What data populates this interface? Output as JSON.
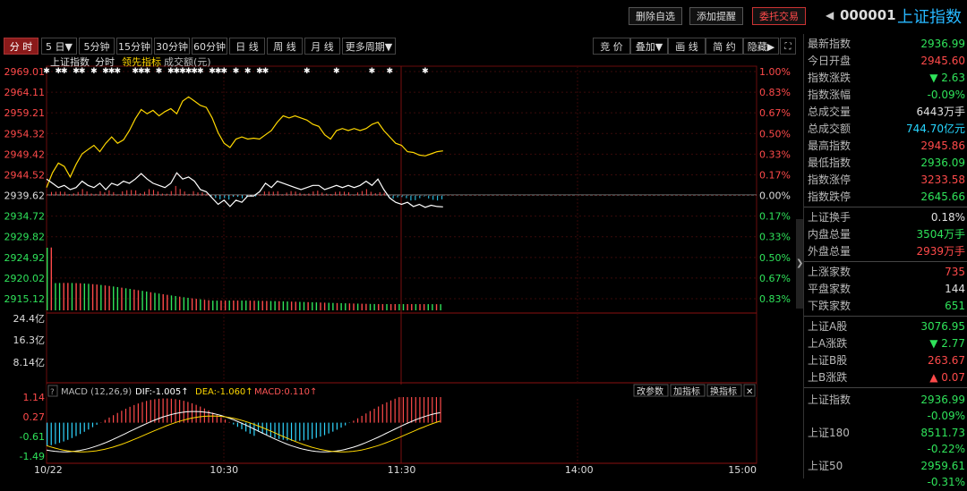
{
  "toolbar": {
    "delete_watch": "删除自选",
    "add_alert": "添加提醒",
    "delegate_trade": "委托交易",
    "code": "000001",
    "name": "上证指数"
  },
  "periods": [
    "分 时",
    "5 日▼",
    "5分钟",
    "15分钟",
    "30分钟",
    "60分钟",
    "日 线",
    "周 线",
    "月 线",
    "更多周期▼"
  ],
  "right_tools": [
    "竞 价",
    "叠加▼",
    "画 线",
    "简 约",
    "隐藏▶"
  ],
  "chart_header": {
    "name": "上证指数",
    "mode": "分时",
    "leader": "领先指标",
    "volume": "成交额(元)"
  },
  "macd_header": {
    "indicator": "MACD (12,26,9)",
    "dif": "DIF:-1.005↑",
    "dea": "DEA:-1.060↑",
    "macd": "MACD:0.110↑",
    "btn_change_params": "改参数",
    "btn_add_indicator": "加指标",
    "btn_swap_indicator": "换指标",
    "btn_close": "✕",
    "btn_help": "?"
  },
  "price_ticks": [
    "2969.01",
    "2964.11",
    "2959.21",
    "2954.32",
    "2949.42",
    "2944.52",
    "2939.62",
    "2934.72",
    "2929.82",
    "2924.92",
    "2920.02",
    "2915.12"
  ],
  "pct_ticks": [
    "1.00%",
    "0.83%",
    "0.67%",
    "0.50%",
    "0.33%",
    "0.17%",
    "0.00%",
    "0.17%",
    "0.33%",
    "0.50%",
    "0.67%",
    "0.83%"
  ],
  "volume_ticks": [
    "24.4亿",
    "16.3亿",
    "8.14亿"
  ],
  "macd_ticks": [
    "1.14",
    "0.27",
    "-0.61",
    "-1.49"
  ],
  "time_ticks": [
    "10/22",
    "10:30",
    "11:30",
    "14:00",
    "15:00"
  ],
  "chart_data": {
    "type": "line",
    "prev_close": 2939.62,
    "price_range": [
      2915.12,
      2969.01
    ],
    "x_range_minutes": [
      0,
      240
    ],
    "series": [
      {
        "name": "上证指数",
        "points": [
          [
            0,
            2941.5
          ],
          [
            2,
            2945.0
          ],
          [
            4,
            2947.3
          ],
          [
            6,
            2946.5
          ],
          [
            8,
            2944.0
          ],
          [
            10,
            2947.0
          ],
          [
            12,
            2949.5
          ],
          [
            14,
            2950.5
          ],
          [
            16,
            2951.5
          ],
          [
            18,
            2950.0
          ],
          [
            20,
            2952.0
          ],
          [
            22,
            2953.5
          ],
          [
            24,
            2952.0
          ],
          [
            26,
            2952.8
          ],
          [
            28,
            2955.0
          ],
          [
            30,
            2957.8
          ],
          [
            32,
            2960.0
          ],
          [
            34,
            2959.0
          ],
          [
            36,
            2959.8
          ],
          [
            38,
            2958.5
          ],
          [
            40,
            2959.5
          ],
          [
            42,
            2960.2
          ],
          [
            44,
            2959.0
          ],
          [
            46,
            2962.0
          ],
          [
            48,
            2963.0
          ],
          [
            50,
            2962.0
          ],
          [
            52,
            2961.0
          ],
          [
            54,
            2960.5
          ],
          [
            56,
            2958.0
          ],
          [
            58,
            2954.5
          ],
          [
            60,
            2952.0
          ],
          [
            62,
            2951.0
          ],
          [
            64,
            2953.0
          ],
          [
            66,
            2953.5
          ],
          [
            68,
            2953.0
          ],
          [
            70,
            2953.2
          ],
          [
            72,
            2953.0
          ],
          [
            74,
            2954.0
          ],
          [
            76,
            2955.0
          ],
          [
            78,
            2957.0
          ],
          [
            80,
            2958.5
          ],
          [
            82,
            2958.0
          ],
          [
            84,
            2958.5
          ],
          [
            86,
            2958.0
          ],
          [
            88,
            2957.5
          ],
          [
            90,
            2956.5
          ],
          [
            92,
            2956.0
          ],
          [
            94,
            2954.0
          ],
          [
            96,
            2953.0
          ],
          [
            98,
            2955.0
          ],
          [
            100,
            2955.5
          ],
          [
            102,
            2955.0
          ],
          [
            104,
            2955.5
          ],
          [
            106,
            2955.0
          ],
          [
            108,
            2955.5
          ],
          [
            110,
            2956.5
          ],
          [
            112,
            2957.0
          ],
          [
            114,
            2955.0
          ],
          [
            116,
            2953.5
          ],
          [
            118,
            2952.0
          ],
          [
            120,
            2951.5
          ],
          [
            122,
            2950.0
          ],
          [
            124,
            2949.8
          ],
          [
            126,
            2949.2
          ],
          [
            128,
            2949.0
          ],
          [
            130,
            2949.5
          ],
          [
            132,
            2950.0
          ],
          [
            134,
            2950.2
          ]
        ]
      },
      {
        "name": "领先指标",
        "points": [
          [
            0,
            2943.5
          ],
          [
            2,
            2942.5
          ],
          [
            4,
            2941.5
          ],
          [
            6,
            2942.0
          ],
          [
            8,
            2941.0
          ],
          [
            10,
            2941.5
          ],
          [
            12,
            2943.0
          ],
          [
            14,
            2942.0
          ],
          [
            16,
            2941.5
          ],
          [
            18,
            2942.5
          ],
          [
            20,
            2941.0
          ],
          [
            22,
            2942.5
          ],
          [
            24,
            2942.0
          ],
          [
            26,
            2943.0
          ],
          [
            28,
            2942.5
          ],
          [
            30,
            2943.5
          ],
          [
            32,
            2944.8
          ],
          [
            34,
            2943.5
          ],
          [
            36,
            2942.5
          ],
          [
            38,
            2942.0
          ],
          [
            40,
            2941.5
          ],
          [
            42,
            2942.5
          ],
          [
            44,
            2945.0
          ],
          [
            46,
            2943.5
          ],
          [
            48,
            2944.0
          ],
          [
            50,
            2943.0
          ],
          [
            52,
            2941.0
          ],
          [
            54,
            2940.5
          ],
          [
            56,
            2939.0
          ],
          [
            58,
            2937.5
          ],
          [
            60,
            2938.5
          ],
          [
            62,
            2937.0
          ],
          [
            64,
            2938.5
          ],
          [
            66,
            2938.0
          ],
          [
            68,
            2939.5
          ],
          [
            70,
            2939.5
          ],
          [
            72,
            2940.5
          ],
          [
            74,
            2942.5
          ],
          [
            76,
            2941.5
          ],
          [
            78,
            2943.0
          ],
          [
            80,
            2942.5
          ],
          [
            82,
            2942.0
          ],
          [
            84,
            2941.5
          ],
          [
            86,
            2941.0
          ],
          [
            88,
            2941.5
          ],
          [
            90,
            2942.0
          ],
          [
            92,
            2942.0
          ],
          [
            94,
            2941.0
          ],
          [
            96,
            2941.5
          ],
          [
            98,
            2942.0
          ],
          [
            100,
            2941.5
          ],
          [
            102,
            2942.0
          ],
          [
            104,
            2941.5
          ],
          [
            106,
            2942.0
          ],
          [
            108,
            2943.0
          ],
          [
            110,
            2942.0
          ],
          [
            112,
            2943.5
          ],
          [
            114,
            2941.0
          ],
          [
            116,
            2939.0
          ],
          [
            118,
            2938.0
          ],
          [
            120,
            2937.5
          ],
          [
            122,
            2938.0
          ],
          [
            124,
            2937.0
          ],
          [
            126,
            2937.5
          ],
          [
            128,
            2936.8
          ],
          [
            130,
            2937.3
          ],
          [
            132,
            2937.0
          ],
          [
            134,
            2936.9
          ]
        ]
      }
    ],
    "volume_range": [
      0,
      24.4
    ],
    "volume_unit": "亿",
    "macd_range": [
      -1.49,
      1.14
    ],
    "dif_last": -1.005,
    "dea_last": -1.06,
    "macd_last": 0.11
  },
  "quote_panel": [
    {
      "label": "最新指数",
      "value": "2936.99",
      "color": "#2fe35a"
    },
    {
      "label": "今日开盘",
      "value": "2945.60",
      "color": "#ff4a4a"
    },
    {
      "label": "指数涨跌",
      "value": "▼ 2.63",
      "color": "#2fe35a"
    },
    {
      "label": "指数涨幅",
      "value": "-0.09%",
      "color": "#2fe35a"
    },
    {
      "label": "总成交量",
      "value": "6443万手",
      "color": "#e0e0e0"
    },
    {
      "label": "总成交额",
      "value": "744.70亿元",
      "color": "#27d6ff"
    },
    {
      "label": "最高指数",
      "value": "2945.86",
      "color": "#ff4a4a"
    },
    {
      "label": "最低指数",
      "value": "2936.09",
      "color": "#2fe35a"
    },
    {
      "label": "指数涨停",
      "value": "3233.58",
      "color": "#ff4a4a"
    },
    {
      "label": "指数跌停",
      "value": "2645.66",
      "color": "#2fe35a"
    }
  ],
  "quote_panel2": [
    {
      "label": "上证换手",
      "value": "0.18%",
      "color": "#e0e0e0"
    },
    {
      "label": "内盘总量",
      "value": "3504万手",
      "color": "#2fe35a"
    },
    {
      "label": "外盘总量",
      "value": "2939万手",
      "color": "#ff4a4a"
    }
  ],
  "quote_panel3": [
    {
      "label": "上涨家数",
      "value": "735",
      "color": "#ff4a4a"
    },
    {
      "label": "平盘家数",
      "value": "144",
      "color": "#e0e0e0"
    },
    {
      "label": "下跌家数",
      "value": "651",
      "color": "#2fe35a"
    }
  ],
  "quote_panel4": [
    {
      "label": "上证A股",
      "value": "3076.95",
      "color": "#2fe35a"
    },
    {
      "label": "上A涨跌",
      "value": "▼ 2.77",
      "color": "#2fe35a"
    },
    {
      "label": "上证B股",
      "value": "263.67",
      "color": "#ff4a4a"
    },
    {
      "label": "上B涨跌",
      "value": "▲ 0.07",
      "color": "#ff4a4a"
    }
  ],
  "related": [
    {
      "label": "上证指数",
      "value": "2936.99",
      "pct": "-0.09%"
    },
    {
      "label": "上证180",
      "value": "8511.73",
      "pct": "-0.22%"
    },
    {
      "label": "上证50",
      "value": "2959.61",
      "pct": "-0.31%"
    }
  ]
}
